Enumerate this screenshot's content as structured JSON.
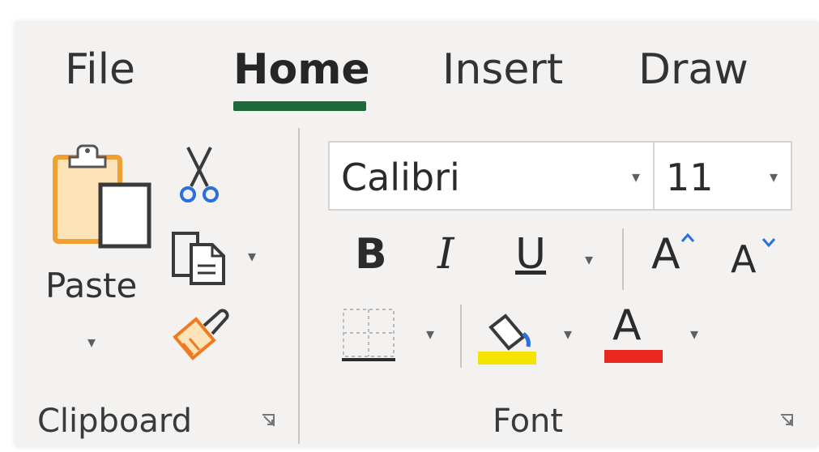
{
  "tabs": [
    {
      "label": "File"
    },
    {
      "label": "Home",
      "active": true
    },
    {
      "label": "Insert"
    },
    {
      "label": "Draw"
    }
  ],
  "clipboard": {
    "group_label": "Clipboard",
    "paste_label": "Paste",
    "icons": [
      "paste-clipboard-icon",
      "cut-scissors-icon",
      "copy-icon",
      "format-painter-icon"
    ]
  },
  "font": {
    "group_label": "Font",
    "font_name": "Calibri",
    "font_size": "11",
    "bold_label": "B",
    "italic_label": "I",
    "underline_label": "U",
    "grow_label": "A",
    "shrink_label": "A",
    "font_color_label": "A",
    "fill_color": "#f4e400",
    "font_color": "#e8281e"
  },
  "colors": {
    "accent": "#1e6b3a",
    "ribbon_bg": "#f3f2f1",
    "clipboard_orange": "#f0a030"
  }
}
